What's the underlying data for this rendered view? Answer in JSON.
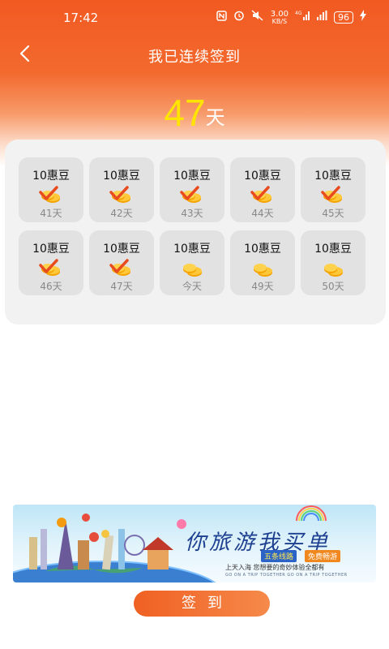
{
  "status_bar": {
    "time": "17:42",
    "speed_value": "3.00",
    "speed_unit": "KB/S",
    "signal": "4G",
    "battery": "96"
  },
  "nav": {
    "title": "我已连续签到",
    "back_icon": "chevron-left-icon"
  },
  "streak": {
    "days": "47",
    "unit": "天"
  },
  "calendar": {
    "days": [
      {
        "reward": "10惠豆",
        "label": "41天",
        "checked": true
      },
      {
        "reward": "10惠豆",
        "label": "42天",
        "checked": true
      },
      {
        "reward": "10惠豆",
        "label": "43天",
        "checked": true
      },
      {
        "reward": "10惠豆",
        "label": "44天",
        "checked": true
      },
      {
        "reward": "10惠豆",
        "label": "45天",
        "checked": true
      },
      {
        "reward": "10惠豆",
        "label": "46天",
        "checked": true
      },
      {
        "reward": "10惠豆",
        "label": "47天",
        "checked": true
      },
      {
        "reward": "10惠豆",
        "label": "今天",
        "checked": false
      },
      {
        "reward": "10惠豆",
        "label": "49天",
        "checked": false
      },
      {
        "reward": "10惠豆",
        "label": "50天",
        "checked": false
      }
    ]
  },
  "banner": {
    "title": "你旅游我买单",
    "tag1": "五条线路",
    "tag2": "免费畅游",
    "subtitle": "上天入海 您想要的奇妙体验全都有",
    "english": "GO ON A TRIP TOGETHER GO ON A TRIP TOGETHER"
  },
  "signin_button": {
    "label": "签到"
  },
  "colors": {
    "header": "#f25a22",
    "streak_number": "#ffe400",
    "button": "#f06023",
    "coin": "#f7b500",
    "check": "#e84c1e"
  }
}
